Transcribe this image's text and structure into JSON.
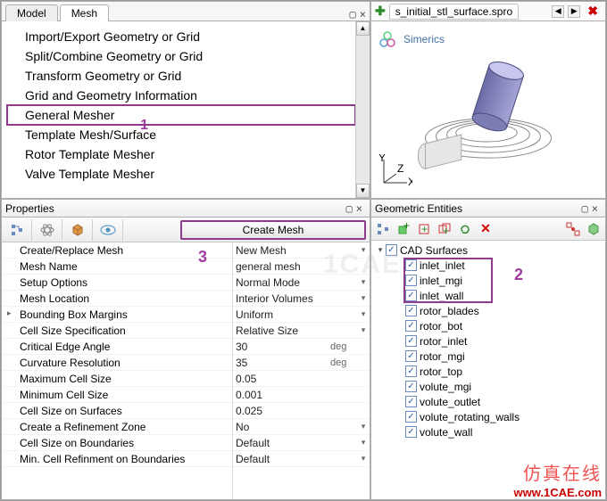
{
  "top_left": {
    "tabs": {
      "model": "Model",
      "mesh": "Mesh",
      "active": "Mesh"
    },
    "items": [
      "Import/Export Geometry or Grid",
      "Split/Combine Geometry or Grid",
      "Transform Geometry or Grid",
      "Grid and Geometry Information",
      "General Mesher",
      "Template Mesh/Surface",
      "Rotor Template Mesher",
      "Valve Template Mesher"
    ],
    "selected_index": 4,
    "annotation": "1"
  },
  "file_tab": {
    "name": "s_initial_stl_surface.spro"
  },
  "brand": "Simerics",
  "axes": {
    "x": "X",
    "y": "Y",
    "z": "Z"
  },
  "properties": {
    "title": "Properties",
    "create_button": "Create Mesh",
    "annotation": "3",
    "rows": [
      {
        "label": "Create/Replace Mesh",
        "value": "New Mesh",
        "dd": true
      },
      {
        "label": "Mesh Name",
        "value": "general mesh"
      },
      {
        "label": "Setup Options",
        "value": "Normal Mode",
        "dd": true
      },
      {
        "label": "Mesh Location",
        "value": "Interior Volumes",
        "dd": true
      },
      {
        "label": "Bounding Box Margins",
        "value": "Uniform",
        "dd": true,
        "caret": true
      },
      {
        "label": "Cell Size Specification",
        "value": "Relative Size",
        "dd": true
      },
      {
        "label": "Critical Edge Angle",
        "value": "30",
        "unit": "deg"
      },
      {
        "label": "Curvature Resolution",
        "value": "35",
        "unit": "deg"
      },
      {
        "label": "Maximum Cell Size",
        "value": "0.05"
      },
      {
        "label": "Minimum Cell Size",
        "value": "0.001"
      },
      {
        "label": "Cell Size on Surfaces",
        "value": "0.025"
      },
      {
        "label": "Create a Refinement Zone",
        "value": "No",
        "dd": true
      },
      {
        "label": "Cell Size on Boundaries",
        "value": "Default",
        "dd": true
      },
      {
        "label": "Min. Cell Refinment on Boundaries",
        "value": "Default",
        "dd": true
      }
    ]
  },
  "entities": {
    "title": "Geometric Entities",
    "root": "CAD Surfaces",
    "annotation": "2",
    "items": [
      "inlet_inlet",
      "inlet_mgi",
      "inlet_wall",
      "rotor_blades",
      "rotor_bot",
      "rotor_inlet",
      "rotor_mgi",
      "rotor_top",
      "volute_mgi",
      "volute_outlet",
      "volute_rotating_walls",
      "volute_wall"
    ],
    "highlight_start": 0,
    "highlight_end": 2
  },
  "watermark": {
    "cn": "仿真在线",
    "url": "www.1CAE.com"
  }
}
